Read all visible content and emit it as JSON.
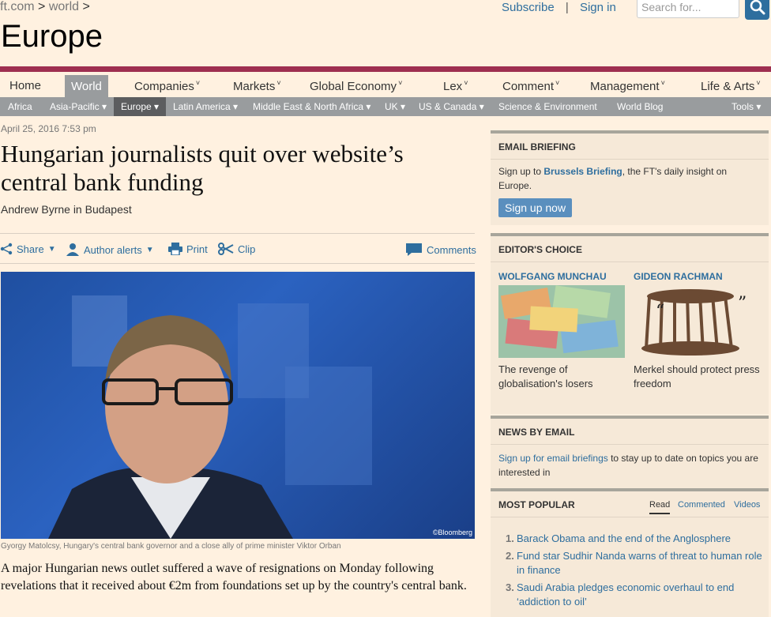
{
  "breadcrumb": {
    "site": "ft.com",
    "sep": ">",
    "section": "world",
    "sep2": ">"
  },
  "toplinks": {
    "subscribe": "Subscribe",
    "sep": "|",
    "signin": "Sign in"
  },
  "search": {
    "placeholder": "Search for..."
  },
  "section_title": "Europe",
  "nav": {
    "items": [
      "Home",
      "World",
      "Companies",
      "Markets",
      "Global Economy",
      "Lex",
      "Comment",
      "Management",
      "Life & Arts"
    ]
  },
  "subnav": {
    "items": [
      "Africa",
      "Asia-Pacific",
      "Europe",
      "Latin America",
      "Middle East & North Africa",
      "UK",
      "US & Canada",
      "Science & Environment",
      "World Blog",
      "Tools"
    ]
  },
  "article": {
    "date": "April 25, 2016 7:53 pm",
    "headline": "Hungarian journalists quit over website’s central bank funding",
    "byline": "Andrew Byrne in Budapest",
    "tools": {
      "share": "Share",
      "author_alerts": "Author alerts",
      "print": "Print",
      "clip": "Clip",
      "comments": "Comments"
    },
    "photo_credit": "©Bloomberg",
    "caption": "Gyorgy Matolcsy, Hungary's central bank governor and a close ally of prime minister Viktor Orban",
    "body": "A major Hungarian news outlet suffered a wave of resignations on Monday following revelations that it received about €2m from foundations set up by the country's central bank."
  },
  "email_briefing": {
    "heading": "EMAIL BRIEFING",
    "text_pre": "Sign up to ",
    "link": "Brussels Briefing",
    "text_post": ", the FT's daily insight on Europe.",
    "button": "Sign up now"
  },
  "editors_choice": {
    "heading": "EDITOR'S CHOICE",
    "items": [
      {
        "author": "WOLFGANG MUNCHAU",
        "title": "The revenge of globalisation's losers"
      },
      {
        "author": "GIDEON RACHMAN",
        "title": "Merkel should protect press freedom"
      }
    ]
  },
  "news_by_email": {
    "heading": "NEWS BY EMAIL",
    "link": "Sign up for email briefings",
    "text": " to stay up to date on topics you are interested in"
  },
  "most_popular": {
    "heading": "MOST POPULAR",
    "tabs": [
      "Read",
      "Commented",
      "Videos"
    ],
    "items": [
      {
        "num": "1.",
        "title": "Barack Obama and the end of the Anglosphere"
      },
      {
        "num": "2.",
        "title": "Fund star Sudhir Nanda warns of threat to human role in finance"
      },
      {
        "num": "3.",
        "title": "Saudi Arabia pledges economic overhaul to end ‘addiction to oil’"
      }
    ]
  },
  "colors": {
    "accent": "#2e6e9e",
    "claret": "#9e2f50",
    "background": "#fff1e0"
  }
}
